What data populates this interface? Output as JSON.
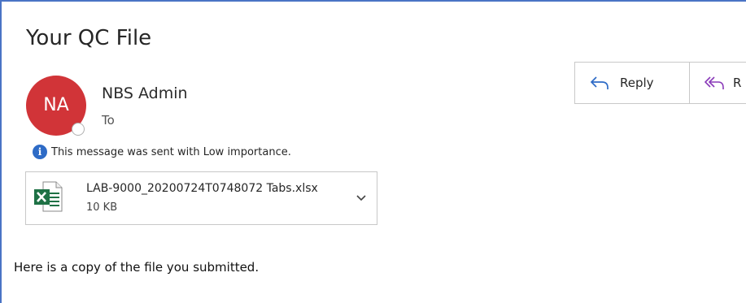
{
  "message": {
    "subject": "Your QC File",
    "sender_initials": "NA",
    "sender_name": "NBS Admin",
    "to_label": "To",
    "importance_notice": "This message was sent with Low importance.",
    "body": "Here is a copy of the file you submitted."
  },
  "attachment": {
    "file_name": "LAB-9000_20200724T0748072 Tabs.xlsx",
    "file_size": "10 KB",
    "icon": "excel-file-icon"
  },
  "actions": {
    "reply_label": "Reply",
    "reply_all_label": "R"
  },
  "colors": {
    "avatar": "#d13438",
    "accent_border": "#4a74c5",
    "reply_icon": "#2e6bc6",
    "reply_all_icon": "#8a3ab9",
    "info_icon": "#2e6bc6",
    "excel_green": "#1e7145"
  }
}
